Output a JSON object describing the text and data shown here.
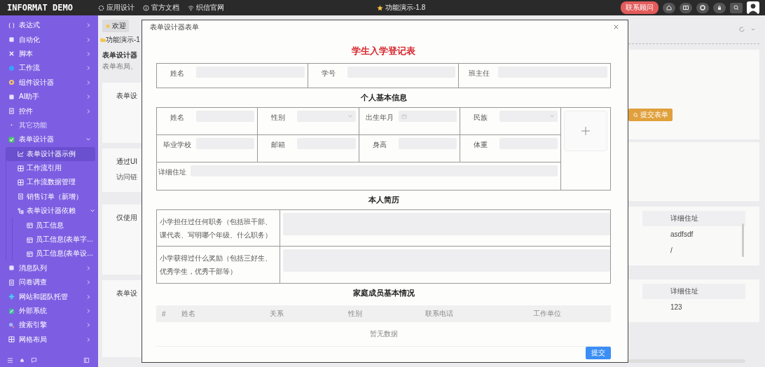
{
  "top_bar": {
    "logo": "INFORMAT DEMO",
    "nav": [
      {
        "label": "应用设计"
      },
      {
        "label": "官方文档"
      },
      {
        "label": "织信官网"
      }
    ],
    "version": "功能演示-1.8",
    "contact_button": "联系顾问"
  },
  "sidebar": {
    "items": [
      {
        "label": "表达式",
        "kind": "item",
        "expanded": false,
        "selected": false
      },
      {
        "label": "自动化",
        "kind": "item",
        "expanded": false,
        "selected": false
      },
      {
        "label": "脚本",
        "kind": "item",
        "expanded": false,
        "selected": false
      },
      {
        "label": "工作流",
        "kind": "item",
        "expanded": false,
        "selected": false
      },
      {
        "label": "组件设计器",
        "kind": "item",
        "expanded": false,
        "selected": false
      },
      {
        "label": "AI助手",
        "kind": "item",
        "expanded": false,
        "selected": false
      },
      {
        "label": "控件",
        "kind": "item",
        "expanded": false,
        "selected": false
      },
      {
        "label": "其它功能",
        "kind": "section",
        "selected": false
      },
      {
        "label": "表单设计器",
        "kind": "item",
        "expanded": true,
        "selected": false,
        "children": [
          {
            "label": "表单设计器示例",
            "selected": true
          },
          {
            "label": "工作流引用",
            "selected": false
          },
          {
            "label": "工作流数据管理",
            "selected": false
          },
          {
            "label": "销售订单（新增）",
            "selected": false
          },
          {
            "label": "表单设计器依赖",
            "expanded": true,
            "selected": false,
            "children": [
              {
                "label": "员工信息",
                "selected": false
              },
              {
                "label": "员工信息(表单字...",
                "selected": false
              },
              {
                "label": "员工信息(表单设...",
                "selected": false
              }
            ]
          }
        ]
      },
      {
        "label": "消息队列",
        "kind": "item",
        "expanded": false,
        "selected": false
      },
      {
        "label": "问卷调查",
        "kind": "item",
        "expanded": false,
        "selected": false
      },
      {
        "label": "网站和团队托管",
        "kind": "item",
        "expanded": false,
        "selected": false
      },
      {
        "label": "外部系统",
        "kind": "item",
        "expanded": false,
        "selected": false
      },
      {
        "label": "搜索引擎",
        "kind": "item",
        "expanded": false,
        "selected": false
      },
      {
        "label": "网格布局",
        "kind": "item",
        "expanded": false,
        "selected": false
      }
    ]
  },
  "background_left": {
    "tab": "欢迎",
    "breadcrumb": "功能演示-1",
    "page_title": "表单设计器",
    "page_description": "表单布局、",
    "card_texts": [
      "表单设",
      "通过UI",
      "访问链",
      "仅使用",
      "表单设"
    ]
  },
  "background_right": {
    "action_button": "提交表单",
    "tables": [
      {
        "column": "详细住址",
        "cells": [
          "asdfsdf",
          "/"
        ]
      },
      {
        "column": "详细住址",
        "cells": [
          "123"
        ]
      }
    ]
  },
  "modal": {
    "title": "表单设计器表单",
    "form_title": "学生入学登记表",
    "header_fields": [
      {
        "label": "姓名",
        "kind": "text"
      },
      {
        "label": "学号",
        "kind": "text"
      },
      {
        "label": "班主任",
        "kind": "text"
      }
    ],
    "basic_info": {
      "title": "个人基本信息",
      "fields": [
        {
          "label": "姓名",
          "kind": "text"
        },
        {
          "label": "性别",
          "kind": "select"
        },
        {
          "label": "出生年月",
          "kind": "date"
        },
        {
          "label": "民族",
          "kind": "select"
        },
        {
          "label": "毕业学校",
          "kind": "text"
        },
        {
          "label": "邮箱",
          "kind": "text"
        },
        {
          "label": "身高",
          "kind": "text"
        },
        {
          "label": "体重",
          "kind": "text"
        },
        {
          "label": "详细住址",
          "kind": "wide"
        }
      ]
    },
    "resume": {
      "title": "本人简历",
      "questions": [
        "小学担任过任何职务（包括班干部、课代表、写明哪个年级、什么职务）",
        "小学获得过什么奖励（包括三好生、优秀学生，优秀干部等）"
      ]
    },
    "family": {
      "title": "家庭成员基本情况",
      "columns": [
        "#",
        "姓名",
        "关系",
        "性别",
        "联系电话",
        "工作单位"
      ],
      "empty_text": "暂无数据"
    },
    "submit_button": "提交"
  }
}
